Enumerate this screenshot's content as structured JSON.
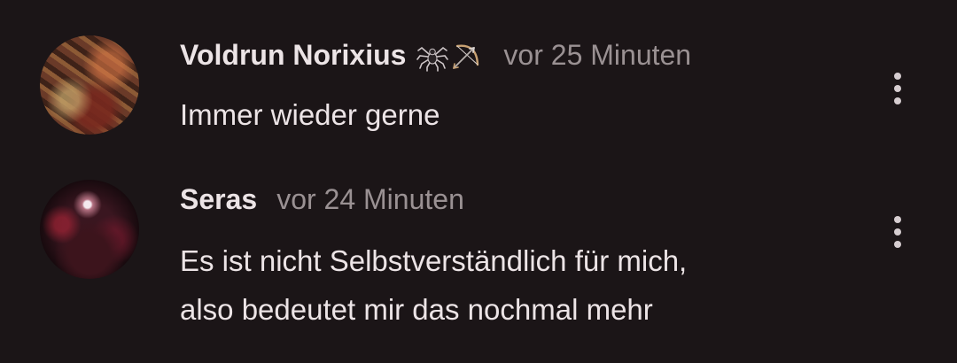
{
  "comments": [
    {
      "author": "Voldrun Norixius",
      "badges": [
        "spider-icon",
        "bow-and-arrow-icon"
      ],
      "time": "vor 25 Minuten",
      "lines": [
        "Immer wieder gerne"
      ]
    },
    {
      "author": "Seras",
      "badges": [],
      "time": "vor 24 Minuten",
      "lines": [
        "Es ist nicht Selbstverständlich für mich,",
        "also bedeutet mir das nochmal mehr"
      ]
    }
  ],
  "colors": {
    "background": "#1b1517",
    "text": "#ece4e6",
    "muted": "#9a9193"
  }
}
